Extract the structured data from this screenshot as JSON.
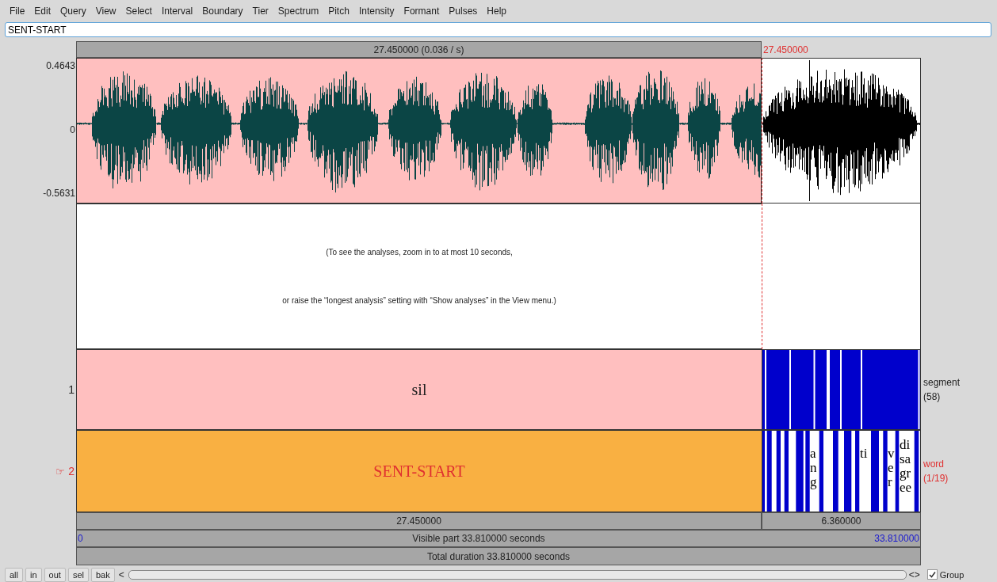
{
  "menu": [
    "File",
    "Edit",
    "Query",
    "View",
    "Select",
    "Interval",
    "Boundary",
    "Tier",
    "Spectrum",
    "Pitch",
    "Intensity",
    "Formant",
    "Pulses",
    "Help"
  ],
  "text_field": {
    "value": "SENT-START"
  },
  "top_bar": {
    "selection": "27.450000 (0.036 / s)",
    "cursor_time": "27.450000"
  },
  "waveform": {
    "y_max": "0.4643",
    "y_zero": "0",
    "y_min": "-0.5631"
  },
  "analysis_message": [
    "(To see the analyses, zoom in to at most 10 seconds,",
    "or raise the “longest analysis” setting with “Show analyses” in the View menu.)"
  ],
  "tiers": [
    {
      "number": "1",
      "name": "segment",
      "count": "(58)",
      "selected": false,
      "selected_text": "sil"
    },
    {
      "number": "2",
      "pointer": "☞",
      "name": "word",
      "count": "(1/19)",
      "selected": true,
      "selected_text": "SENT-START",
      "labels": [
        "a n g",
        "ti",
        "v e r",
        "di sa gr ee"
      ]
    }
  ],
  "durations": [
    "27.450000",
    "6.360000"
  ],
  "visible": {
    "start": "0",
    "label": "Visible part 33.810000 seconds",
    "end": "33.810000"
  },
  "total": "Total duration 33.810000 seconds",
  "buttons": [
    "all",
    "in",
    "out",
    "sel",
    "bak"
  ],
  "scroll": {
    "left": "<",
    "right": "<>"
  },
  "group": {
    "label": "Group",
    "checked": true
  }
}
